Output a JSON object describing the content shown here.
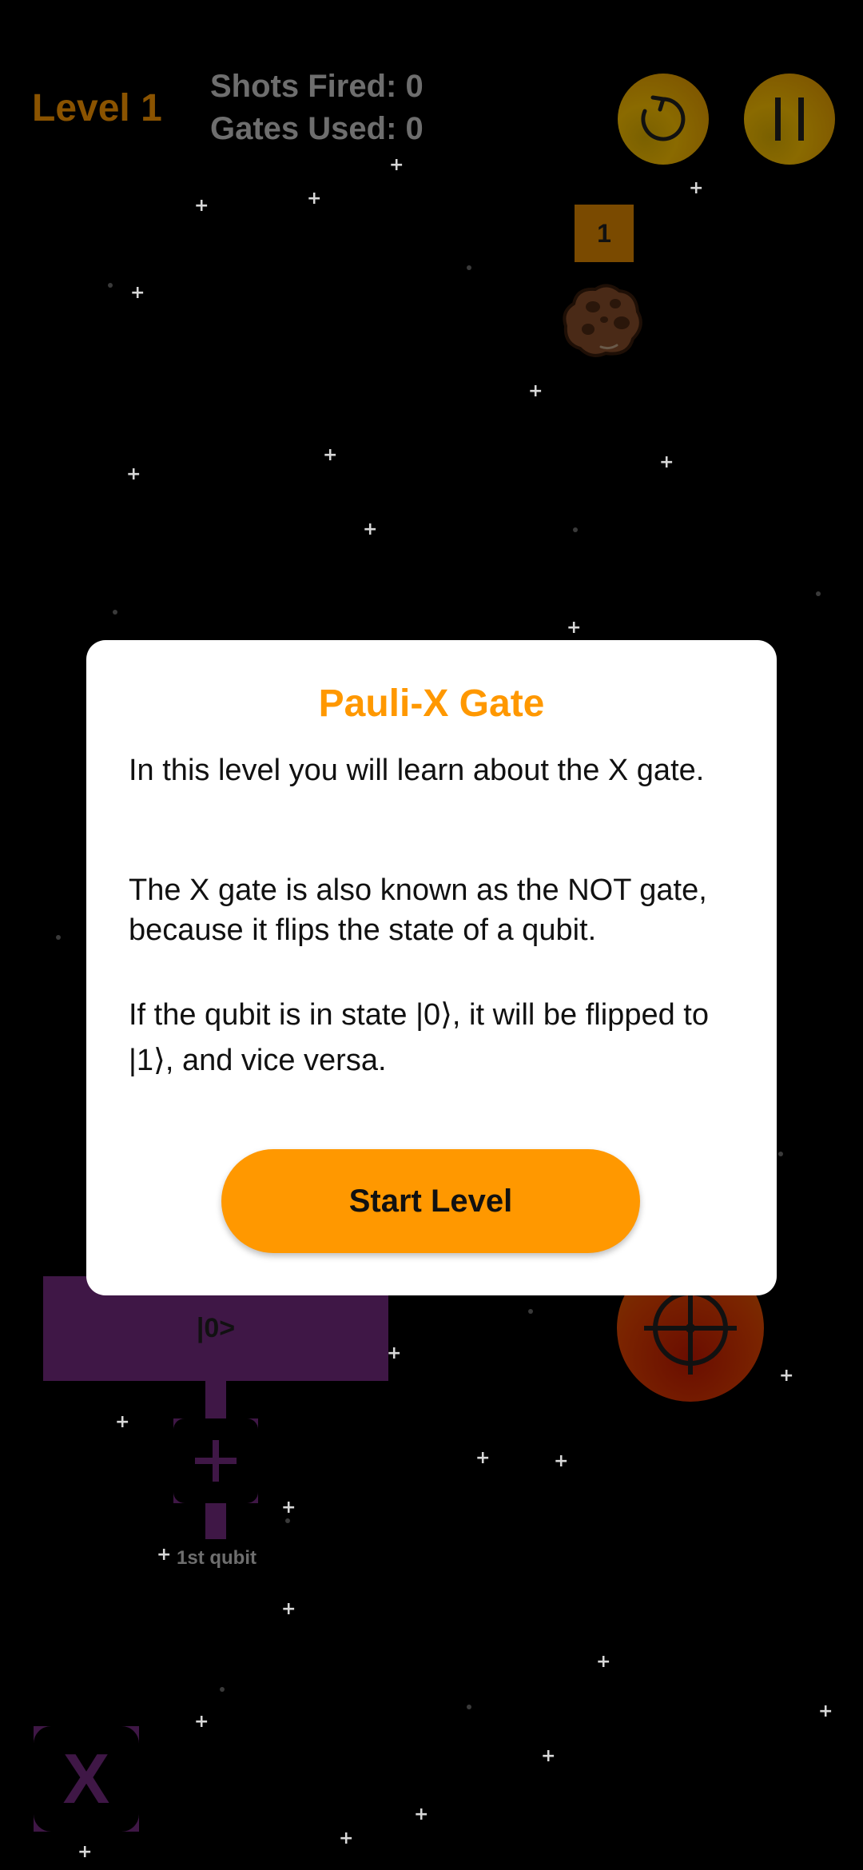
{
  "hud": {
    "level": "Level 1",
    "shots_fired": "Shots Fired: 0",
    "gates_used": "Gates Used: 0",
    "restart_icon": "restart-icon",
    "pause_icon": "pause-icon"
  },
  "asteroid": {
    "hit_points": "1",
    "icon": "asteroid-icon"
  },
  "circuit": {
    "qubit_state": "|0>",
    "qubit_label": "1st qubit",
    "add_gate_icon": "plus-icon",
    "fire_icon": "crosshair-icon"
  },
  "gate_palette": {
    "x_gate_label": "X"
  },
  "dialog": {
    "title": "Pauli-X Gate",
    "paragraph_1": "In this level you will learn about the X gate.",
    "paragraph_2": "The X gate is also known as the NOT gate, because it flips the state of a qubit.",
    "paragraph_3": "If the qubit is in state |0⟩, it will be flipped to |1⟩, and vice versa.",
    "start_button": "Start Level"
  },
  "colors": {
    "accent": "#ff9800",
    "background": "#000000",
    "circuit_purple": "#3f1746",
    "dialog_background": "#ffffff"
  }
}
